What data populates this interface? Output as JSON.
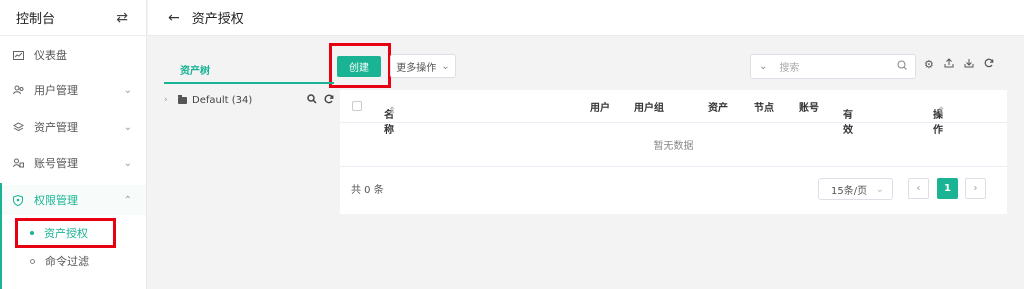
{
  "sidebar": {
    "title": "控制台",
    "swap_icon": "⇄",
    "items": [
      {
        "label": "仪表盘",
        "icon": "dashboard-icon"
      },
      {
        "label": "用户管理",
        "icon": "users-icon"
      },
      {
        "label": "资产管理",
        "icon": "layers-icon"
      },
      {
        "label": "账号管理",
        "icon": "account-icon"
      },
      {
        "label": "权限管理",
        "icon": "shield-icon"
      }
    ],
    "sub_items": [
      {
        "label": "资产授权"
      },
      {
        "label": "命令过滤"
      }
    ]
  },
  "header": {
    "title": "资产授权",
    "back_icon": "←"
  },
  "tree": {
    "tab_label": "资产树",
    "node_label": "Default (34)"
  },
  "toolbar": {
    "create_label": "创建",
    "more_label": "更多操作",
    "search_placeholder": "搜索"
  },
  "table": {
    "columns": [
      "名称",
      "用户",
      "用户组",
      "资产",
      "节点",
      "账号",
      "有效",
      "操作"
    ],
    "empty_text": "暂无数据",
    "total_text": "共 0 条",
    "page_size": "15条/页",
    "current_page": "1"
  },
  "colors": {
    "accent": "#1ab394",
    "highlight": "#e60012"
  }
}
